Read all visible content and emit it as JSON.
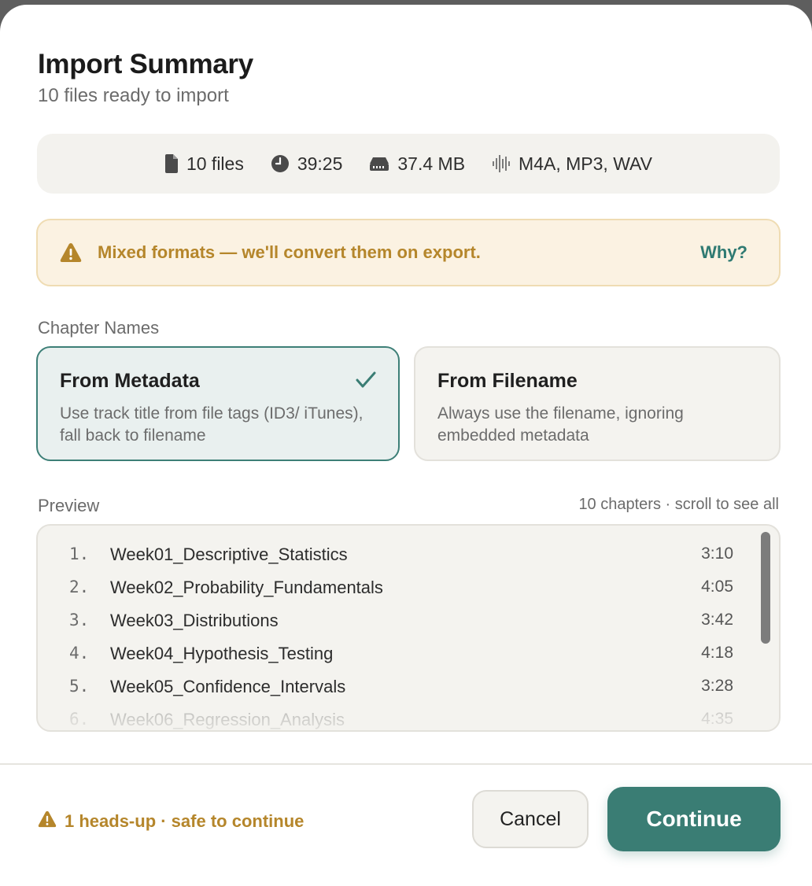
{
  "dialog": {
    "title": "Import Summary",
    "subtitle": "10 files ready to import"
  },
  "stats": {
    "files": "10 files",
    "duration": "39:25",
    "size": "37.4 MB",
    "formats": "M4A, MP3, WAV",
    "icons": [
      "file-icon",
      "clock-icon",
      "drive-icon",
      "waveform-icon"
    ]
  },
  "warning": {
    "text": "Mixed formats — we'll convert them on export.",
    "link": "Why?",
    "color": "#b5862b"
  },
  "chapter_names": {
    "label": "Chapter Names",
    "options": [
      {
        "title": "From Metadata",
        "description": "Use track title from file tags (ID3/ iTunes), fall back to filename",
        "selected": true
      },
      {
        "title": "From Filename",
        "description": "Always use the filename, ignoring embedded metadata",
        "selected": false
      }
    ]
  },
  "preview": {
    "label": "Preview",
    "meta": "10 chapters · scroll to see all",
    "chapters": [
      {
        "num": "1.",
        "name": "Week01_Descriptive_Statistics",
        "duration": "3:10"
      },
      {
        "num": "2.",
        "name": "Week02_Probability_Fundamentals",
        "duration": "4:05"
      },
      {
        "num": "3.",
        "name": "Week03_Distributions",
        "duration": "3:42"
      },
      {
        "num": "4.",
        "name": "Week04_Hypothesis_Testing",
        "duration": "4:18"
      },
      {
        "num": "5.",
        "name": "Week05_Confidence_Intervals",
        "duration": "3:28"
      },
      {
        "num": "6.",
        "name": "Week06_Regression_Analysis",
        "duration": "4:35"
      }
    ]
  },
  "footer": {
    "status": "1 heads-up · safe to continue",
    "cancel_label": "Cancel",
    "continue_label": "Continue",
    "accent": "#3a7d74"
  }
}
